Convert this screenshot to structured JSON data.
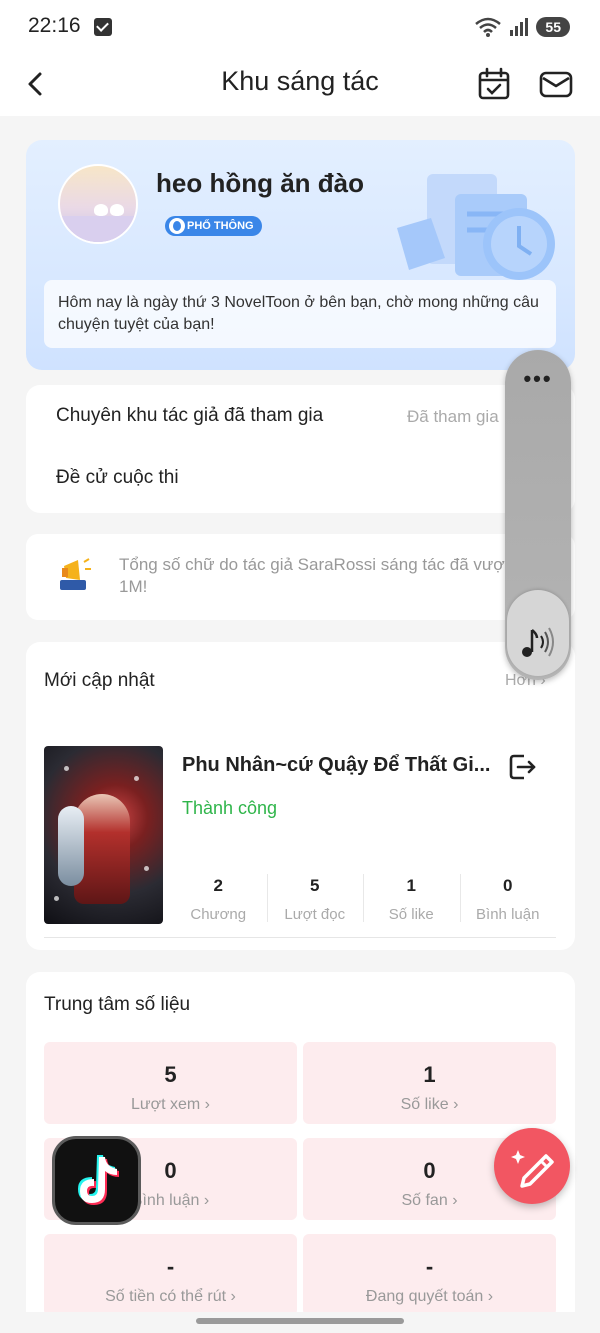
{
  "status_bar": {
    "time": "22:16",
    "battery": "55"
  },
  "nav": {
    "title": "Khu sáng tác"
  },
  "profile": {
    "username": "heo hồng ăn đào",
    "tier": "PHỔ THÔNG",
    "greeting": "Hôm nay là ngày thứ 3 NovelToon ở bên bạn, chờ mong những câu chuyện tuyệt của bạn!"
  },
  "author_rows": [
    {
      "label": "Chuyên khu tác giả đã tham gia",
      "value": "Đã tham gia"
    },
    {
      "label": "Đề cử cuộc thi",
      "value": ""
    }
  ],
  "notice": {
    "text": "Tổng số chữ do tác giả SaraRossi sáng tác đã vượt 1M!"
  },
  "updates": {
    "title": "Mới cập nhật",
    "more": "Hơn",
    "book": {
      "title": "Phu Nhân~cứ Quậy Để Thất Gi...",
      "status": "Thành công",
      "stats": [
        {
          "value": "2",
          "label": "Chương"
        },
        {
          "value": "5",
          "label": "Lượt đọc"
        },
        {
          "value": "1",
          "label": "Số like"
        },
        {
          "value": "0",
          "label": "Bình luận"
        }
      ]
    }
  },
  "data_center": {
    "title": "Trung tâm số liệu",
    "tiles": [
      {
        "value": "5",
        "label": "Lượt xem"
      },
      {
        "value": "1",
        "label": "Số like"
      },
      {
        "value": "0",
        "label": "Bình luận"
      },
      {
        "value": "0",
        "label": "Số fan"
      },
      {
        "value": "-",
        "label": "Số tiền có thể rút"
      },
      {
        "value": "-",
        "label": "Đang quyết toán"
      }
    ]
  },
  "floating_panel": {
    "menu_glyph": "•••"
  },
  "colors": {
    "accent_green": "#2fb54a",
    "tile_bg": "#fdecee",
    "fab": "#f25662",
    "badge": "#3a86e8"
  }
}
